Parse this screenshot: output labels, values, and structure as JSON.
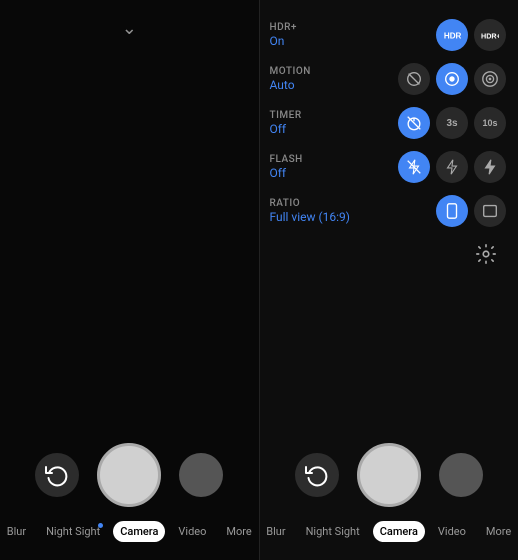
{
  "leftPanel": {
    "tabs": [
      {
        "id": "blur",
        "label": "Blur",
        "active": false,
        "dot": false
      },
      {
        "id": "night-sight",
        "label": "Night Sight",
        "active": false,
        "dot": true
      },
      {
        "id": "camera",
        "label": "Camera",
        "active": true,
        "dot": false
      },
      {
        "id": "video",
        "label": "Video",
        "active": false,
        "dot": false
      },
      {
        "id": "more",
        "label": "More",
        "active": false,
        "dot": false
      }
    ]
  },
  "rightPanel": {
    "settings": [
      {
        "id": "hdr",
        "label": "HDR+",
        "value": "On"
      },
      {
        "id": "motion",
        "label": "MOTION",
        "value": "Auto"
      },
      {
        "id": "timer",
        "label": "TIMER",
        "value": "Off"
      },
      {
        "id": "flash",
        "label": "FLASH",
        "value": "Off"
      },
      {
        "id": "ratio",
        "label": "RATIO",
        "value": "Full view (16:9)"
      }
    ],
    "tabs": [
      {
        "id": "blur",
        "label": "Blur",
        "active": false,
        "dot": false
      },
      {
        "id": "night-sight",
        "label": "Night Sight",
        "active": false,
        "dot": false
      },
      {
        "id": "camera",
        "label": "Camera",
        "active": true,
        "dot": false
      },
      {
        "id": "video",
        "label": "Video",
        "active": false,
        "dot": false
      },
      {
        "id": "more",
        "label": "More",
        "active": false,
        "dot": false
      }
    ]
  }
}
